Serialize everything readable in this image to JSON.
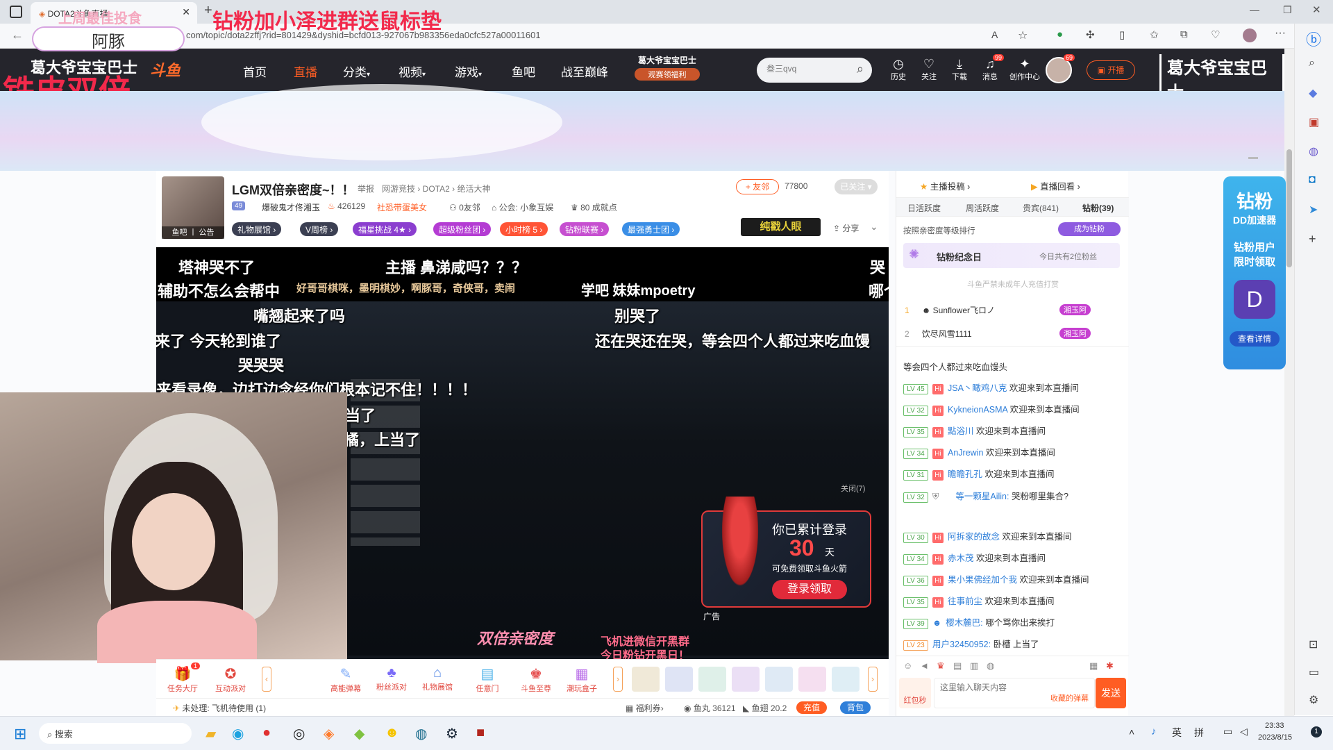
{
  "browser": {
    "tab_title": "DOTA2斗鱼直播",
    "url": "com/topic/dota2zffj?rid=801429&dyshid=bcfd013-927067b983356eda0cfc527a00011601",
    "back_icon": "arrow-left-icon"
  },
  "overlays": {
    "line1": "上周最佳投食",
    "line2": "阿豚",
    "line3": "铁皮双倍",
    "line4": "钻粉加小泽进群送鼠标垫"
  },
  "header": {
    "logo_left": "葛大爷宝宝巴士",
    "site_logo": "斗鱼",
    "nav": [
      "首页",
      "直播",
      "分类",
      "视频",
      "游戏",
      "鱼吧",
      "战至巅峰"
    ],
    "promo_title": "葛大爷宝宝巴士",
    "promo_sub": "观赛领福利",
    "search_placeholder": "叁三qvq",
    "icons": [
      {
        "label": "历史",
        "icon": "clock-icon"
      },
      {
        "label": "关注",
        "icon": "heart-icon"
      },
      {
        "label": "下载",
        "icon": "download-icon"
      },
      {
        "label": "消息",
        "icon": "bell-icon",
        "badge": "99"
      },
      {
        "label": "创作中心",
        "icon": "bulb-icon"
      }
    ],
    "avatar_badge": "69",
    "live_button": "开播",
    "logo_right": "葛大爷宝宝巴士"
  },
  "room": {
    "title": "LGM双倍亲密度~！！",
    "report": "举报",
    "breadcrumb": "网游竞技 › DOTA2 › 绝活大神",
    "fans_button": "+ 友邻",
    "fans_count": "77800",
    "followed": "已关注",
    "level": "49",
    "nickname": "爆破鬼才佟湘玉",
    "hot": "426129",
    "society": "社恐带蛋美女",
    "friends": "0友邻",
    "guild": "公会: 小象互娱",
    "achievements": "80 成就点",
    "avatar_caption": "鱼吧 丨 公告",
    "tags": [
      "礼物展馆",
      "V周榜",
      "福星挑战 4★",
      "超级粉丝团",
      "小时榜 5",
      "钻粉联赛",
      "最强勇士团"
    ],
    "share": "分享",
    "badge_right": "纯戳人眼"
  },
  "video": {
    "danmaku": [
      "塔神哭不了",
      "主播 鼻涕咸吗？？？",
      "哭",
      "辅助不怎么会帮中",
      "好哥哥棋咪，墨明棋妙，啊豚哥，奇侠哥，卖闹",
      "学吧 妹妹mpoetry",
      "哪个",
      "嘴翘起来了吗",
      "别哭了",
      "来了 今天轮到谁了",
      "还在哭还在哭，等会四个人都过来吃血馒",
      "哭哭哭",
      "来看录像，边打边念经你们根本记不住！！！！",
      "当了",
      "橘，上当了"
    ],
    "close_label": "关闭(7)",
    "bottom_banner1": "双倍亲密度",
    "bottom_banner2": "飞机进微信开黑群",
    "bottom_banner3": "今日粉钻开黑日！",
    "ad_label": "广告",
    "ad": {
      "line1": "你已累计登录",
      "days": "30",
      "unit": "天",
      "line2": "可免费领取斗鱼火箭",
      "button": "登录领取"
    }
  },
  "chat": {
    "tabs_top": [
      "主播投稿",
      "直播回看"
    ],
    "tabs": [
      "日活跃度",
      "周活跃度",
      "贵宾(841)",
      "钻粉(39)"
    ],
    "rank_caption": "按照亲密度等级排行",
    "become_fan": "成为钻粉",
    "anniversary": "钻粉纪念日",
    "anniversary_sub": "今日共有2位粉丝",
    "notice": "斗鱼严禁未成年人充值打赏",
    "rank": [
      {
        "n": "1",
        "name": "Sunflower飞ロノ",
        "badge": "湘玉阿"
      },
      {
        "n": "2",
        "name": "饮尽风雪1111",
        "badge": "湘玉阿"
      }
    ],
    "partial": "等会四个人都过来吃血馒头",
    "messages": [
      {
        "lv": "LV 45",
        "user": "JSA丶瞰鸡八克",
        "text": "欢迎来到本直播间"
      },
      {
        "lv": "LV 32",
        "user": "KykneionASMA",
        "text": "欢迎来到本直播间"
      },
      {
        "lv": "LV 35",
        "user": "點浴川",
        "text": "欢迎来到本直播间"
      },
      {
        "lv": "LV 34",
        "user": "AnJrewin",
        "text": "欢迎来到本直播间"
      },
      {
        "lv": "LV 31",
        "user": "瞻瞻孔孔",
        "text": "欢迎来到本直播间"
      },
      {
        "lv": "LV 32",
        "user": "等一颗星Ailin:",
        "text": "哭粉哪里集合?"
      },
      {
        "lv": "LV 30",
        "user": "阿拆家的故念",
        "text": "欢迎来到本直播间"
      },
      {
        "lv": "LV 34",
        "user": "赤木茂",
        "text": "欢迎来到本直播间"
      },
      {
        "lv": "LV 36",
        "user": "果小果佛经加个我",
        "text": "欢迎来到本直播间"
      },
      {
        "lv": "LV 35",
        "user": "往事前尘",
        "text": "欢迎来到本直播间"
      },
      {
        "lv": "LV 39",
        "user": "樱木麓巴:",
        "text": "哪个骂你出来挨打"
      },
      {
        "lv": "LV 23",
        "user": "用户32450952:",
        "text": "卧槽 上当了"
      }
    ],
    "input_placeholder": "这里输入聊天内容",
    "saved": "收藏的弹幕",
    "send": "发送",
    "red_pack": "红包秒"
  },
  "gifts": {
    "items": [
      "任务大厅",
      "互动派对",
      "高能弹幕",
      "粉丝派对",
      "礼物展馆",
      "任意门",
      "斗鱼至尊",
      "潮玩盒子"
    ],
    "badge_task": "1"
  },
  "status": {
    "pending": "未处理: 飞机待使用 (1)",
    "welfare": "福利券",
    "fishball": "鱼丸 36121",
    "fishfin": "鱼翅 20.2",
    "recharge": "充值",
    "bag": "背包"
  },
  "promo_right": {
    "title": "钻粉",
    "sub": "DD加速器",
    "line1": "钻粉用户",
    "line2": "限时领取",
    "btn": "查看详情"
  },
  "taskbar": {
    "search": "搜索",
    "ime1": "英",
    "ime2": "拼",
    "time": "23:33",
    "date": "2023/8/15"
  }
}
